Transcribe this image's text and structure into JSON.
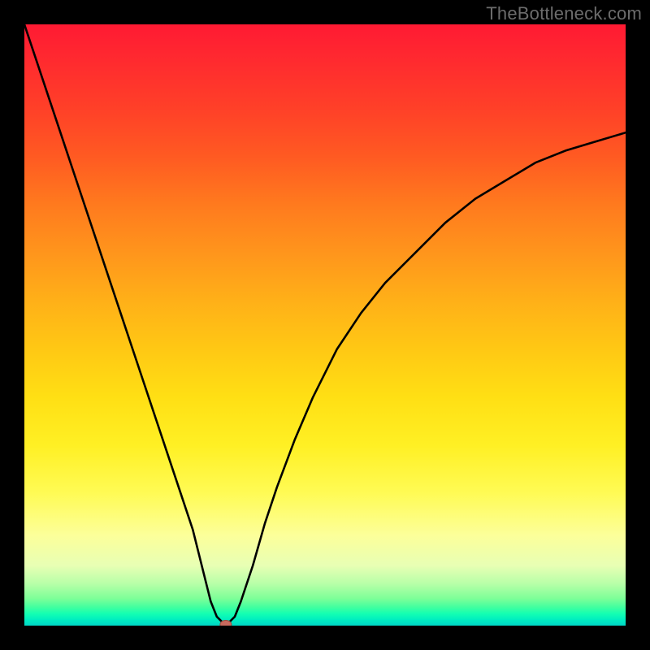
{
  "watermark": {
    "text": "TheBottleneck.com"
  },
  "colors": {
    "curve_stroke": "#000000",
    "marker_fill": "#c96a5e",
    "marker_stroke": "#9a4a40",
    "frame": "#000000"
  },
  "chart_data": {
    "type": "line",
    "title": "",
    "xlabel": "",
    "ylabel": "",
    "xlim": [
      0,
      100
    ],
    "ylim": [
      0,
      100
    ],
    "grid": false,
    "legend": false,
    "series": [
      {
        "name": "bottleneck-curve",
        "x": [
          0,
          2,
          4,
          6,
          8,
          10,
          12,
          14,
          16,
          18,
          20,
          22,
          24,
          26,
          28,
          30,
          31,
          32,
          33,
          33.5,
          34,
          35,
          36,
          38,
          40,
          42,
          45,
          48,
          52,
          56,
          60,
          65,
          70,
          75,
          80,
          85,
          90,
          95,
          100
        ],
        "values": [
          100,
          94,
          88,
          82,
          76,
          70,
          64,
          58,
          52,
          46,
          40,
          34,
          28,
          22,
          16,
          8,
          4,
          1.5,
          0.5,
          0.2,
          0.5,
          1.5,
          4,
          10,
          17,
          23,
          31,
          38,
          46,
          52,
          57,
          62,
          67,
          71,
          74,
          77,
          79,
          80.5,
          82
        ]
      }
    ],
    "annotations": [
      {
        "type": "marker",
        "x": 33.5,
        "y": 0.2,
        "shape": "ellipse",
        "label": ""
      }
    ]
  }
}
